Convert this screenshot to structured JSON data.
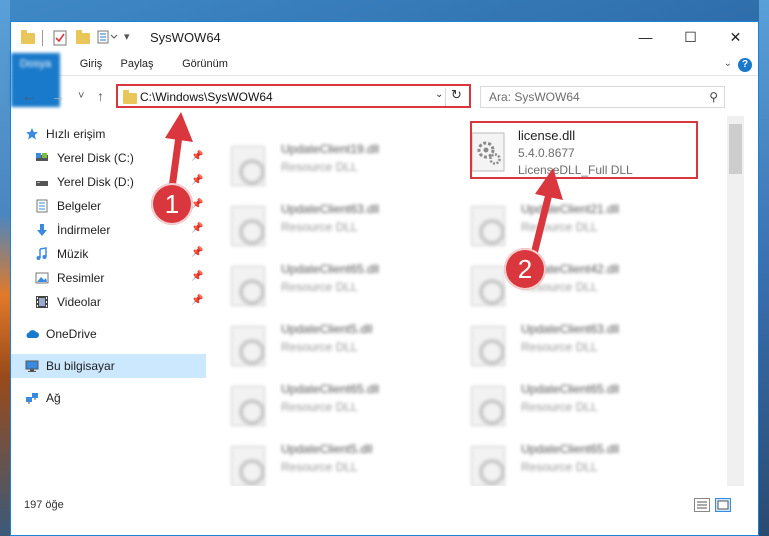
{
  "window": {
    "title": "SysWOW64",
    "minimize": "—",
    "maximize": "☐",
    "close": "✕"
  },
  "ribbon": {
    "tabs": [
      "Dosya",
      "Giriş",
      "Paylaş",
      "Görünüm"
    ],
    "help": "?"
  },
  "nav": {
    "back": "←",
    "forward": "→",
    "recent": "˅",
    "up": "↑",
    "address": "C:\\Windows\\SysWOW64",
    "search_placeholder": "Ara: SysWOW64"
  },
  "sidebar": {
    "items": [
      {
        "label": "Hızlı erişim",
        "icon": "star-icon",
        "pinned": false
      },
      {
        "label": "Yerel Disk (C:)",
        "icon": "drive-icon",
        "pinned": true
      },
      {
        "label": "Yerel Disk (D:)",
        "icon": "drive-icon",
        "pinned": true
      },
      {
        "label": "Belgeler",
        "icon": "documents-icon",
        "pinned": true
      },
      {
        "label": "İndirmeler",
        "icon": "download-icon",
        "pinned": true
      },
      {
        "label": "Müzik",
        "icon": "music-icon",
        "pinned": true
      },
      {
        "label": "Resimler",
        "icon": "pictures-icon",
        "pinned": true
      },
      {
        "label": "Videolar",
        "icon": "video-icon",
        "pinned": true
      },
      {
        "label": "OneDrive",
        "icon": "cloud-icon",
        "pinned": false
      },
      {
        "label": "Bu bilgisayar",
        "icon": "computer-icon",
        "pinned": false
      },
      {
        "label": "Ağ",
        "icon": "network-icon",
        "pinned": false
      }
    ]
  },
  "files": {
    "left": [
      {
        "name": "UpdateClient19.dll",
        "desc": "Resource DLL"
      },
      {
        "name": "UpdateClient63.dll",
        "desc": "Resource DLL"
      },
      {
        "name": "UpdateClient65.dll",
        "desc": "Resource DLL"
      },
      {
        "name": "UpdateClient5.dll",
        "desc": "Resource DLL"
      },
      {
        "name": "UpdateClient65.dll",
        "desc": "Resource DLL"
      },
      {
        "name": "UpdateClient5.dll",
        "desc": "Resource DLL"
      }
    ],
    "right": [
      {
        "name": "license.dll",
        "version": "5.4.0.8677",
        "desc": "LicenseDLL_Full DLL"
      },
      {
        "name": "UpdateClient21.dll",
        "desc": "Resource DLL"
      },
      {
        "name": "UpdateClient42.dll",
        "desc": "Resource DLL"
      },
      {
        "name": "UpdateClient63.dll",
        "desc": "Resource DLL"
      },
      {
        "name": "UpdateClient65.dll",
        "desc": "Resource DLL"
      },
      {
        "name": "UpdateClient65.dll",
        "desc": "Resource DLL"
      }
    ]
  },
  "status": {
    "count": "197 öğe"
  },
  "annotations": {
    "badge1": "1",
    "badge2": "2",
    "color": "#d9363e"
  }
}
